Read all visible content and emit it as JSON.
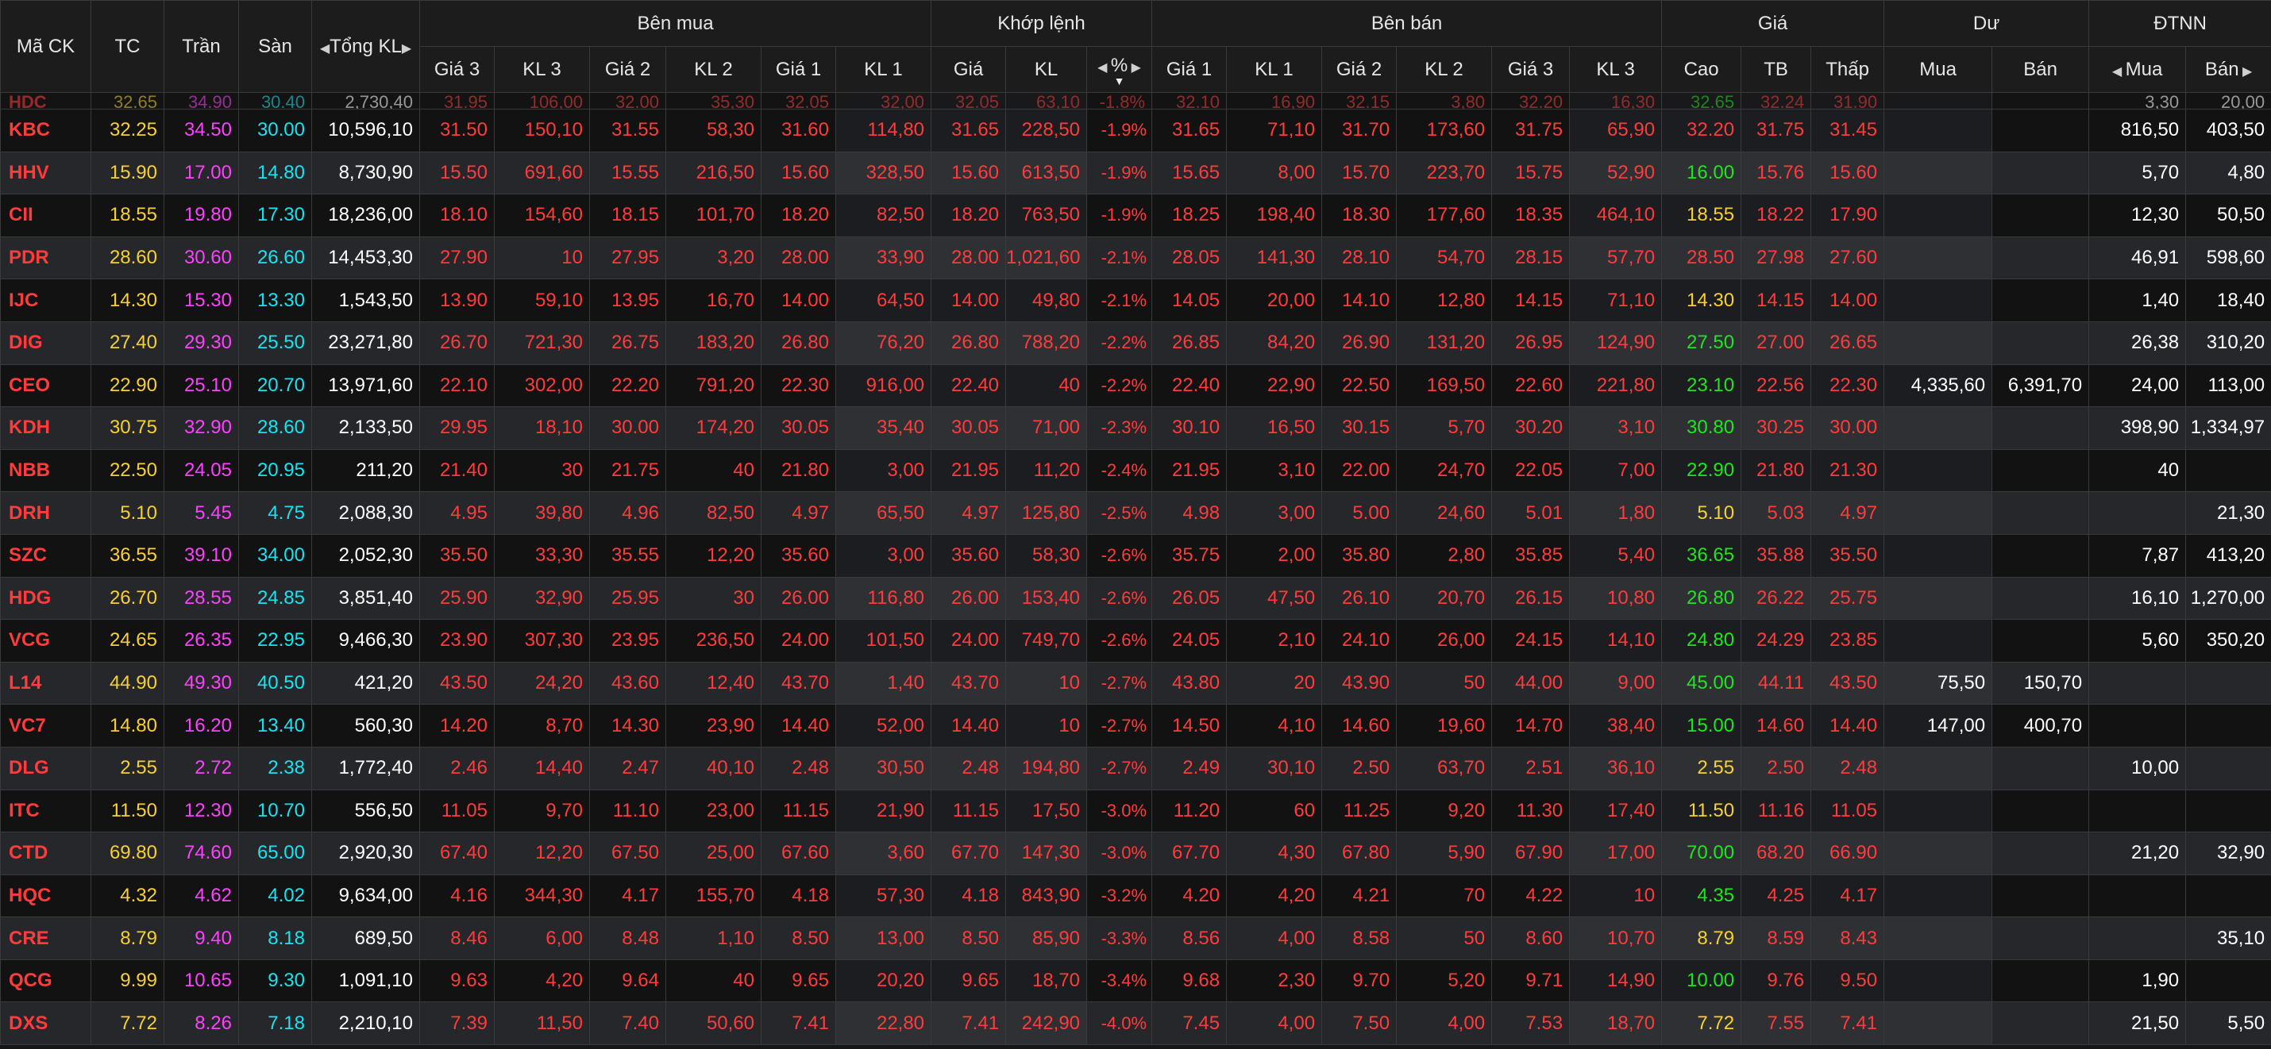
{
  "header": {
    "top": {
      "symbol": "Mã CK",
      "ref": "TC",
      "ceiling": "Trần",
      "floor": "Sàn",
      "total_volume": "Tổng KL",
      "buy": "Bên mua",
      "match": "Khớp lệnh",
      "sell": "Bên bán",
      "price": "Giá",
      "surplus": "Dư",
      "foreign": "ĐTNN"
    },
    "sub": {
      "buy": [
        "Giá 3",
        "KL 3",
        "Giá 2",
        "KL 2",
        "Giá 1",
        "KL 1"
      ],
      "match": [
        "Giá",
        "KL",
        "%"
      ],
      "sell": [
        "Giá 1",
        "KL 1",
        "Giá 2",
        "KL 2",
        "Giá 3",
        "KL 3"
      ],
      "price": [
        "Cao",
        "TB",
        "Thấp"
      ],
      "surplus": [
        "Mua",
        "Bán"
      ],
      "foreign": [
        "Mua",
        "Bán"
      ]
    }
  },
  "partial_row": [
    "HDC",
    "32.65",
    "34.90",
    "30.40",
    "2,730,40",
    "31.95",
    "106,00",
    "32.00",
    "35,30",
    "32.05",
    "32,00",
    "32.05",
    "63,10",
    "-1.8%",
    "32.10",
    "16,90",
    "32.15",
    "3,80",
    "32.20",
    "16,30",
    "32.65",
    "32.24",
    "31.90",
    "",
    "",
    "3,30",
    "20,00"
  ],
  "rows": [
    {
      "s": "KBC",
      "c": [
        "32.25",
        "34.50",
        "30.00",
        "10,596,10",
        "31.50",
        "150,10",
        "31.55",
        "58,30",
        "31.60",
        "114,80",
        "31.65",
        "228,50",
        "-1.9%",
        "31.65",
        "71,10",
        "31.70",
        "173,60",
        "31.75",
        "65,90",
        "32.20",
        "31.75",
        "31.45",
        "",
        "",
        "816,50",
        "403,50"
      ],
      "hi": "r"
    },
    {
      "s": "HHV",
      "c": [
        "15.90",
        "17.00",
        "14.80",
        "8,730,90",
        "15.50",
        "691,60",
        "15.55",
        "216,50",
        "15.60",
        "328,50",
        "15.60",
        "613,50",
        "-1.9%",
        "15.65",
        "8,00",
        "15.70",
        "223,70",
        "15.75",
        "52,90",
        "16.00",
        "15.76",
        "15.60",
        "",
        "",
        "5,70",
        "4,80"
      ],
      "hi": "g"
    },
    {
      "s": "CII",
      "c": [
        "18.55",
        "19.80",
        "17.30",
        "18,236,00",
        "18.10",
        "154,60",
        "18.15",
        "101,70",
        "18.20",
        "82,50",
        "18.20",
        "763,50",
        "-1.9%",
        "18.25",
        "198,40",
        "18.30",
        "177,60",
        "18.35",
        "464,10",
        "18.55",
        "18.22",
        "17.90",
        "",
        "",
        "12,30",
        "50,50"
      ],
      "hi": "y"
    },
    {
      "s": "PDR",
      "c": [
        "28.60",
        "30.60",
        "26.60",
        "14,453,30",
        "27.90",
        "10",
        "27.95",
        "3,20",
        "28.00",
        "33,90",
        "28.00",
        "1,021,60",
        "-2.1%",
        "28.05",
        "141,30",
        "28.10",
        "54,70",
        "28.15",
        "57,70",
        "28.50",
        "27.98",
        "27.60",
        "",
        "",
        "46,91",
        "598,60"
      ],
      "hi": "r"
    },
    {
      "s": "IJC",
      "c": [
        "14.30",
        "15.30",
        "13.30",
        "1,543,50",
        "13.90",
        "59,10",
        "13.95",
        "16,70",
        "14.00",
        "64,50",
        "14.00",
        "49,80",
        "-2.1%",
        "14.05",
        "20,00",
        "14.10",
        "12,80",
        "14.15",
        "71,10",
        "14.30",
        "14.15",
        "14.00",
        "",
        "",
        "1,40",
        "18,40"
      ],
      "hi": "y"
    },
    {
      "s": "DIG",
      "c": [
        "27.40",
        "29.30",
        "25.50",
        "23,271,80",
        "26.70",
        "721,30",
        "26.75",
        "183,20",
        "26.80",
        "76,20",
        "26.80",
        "788,20",
        "-2.2%",
        "26.85",
        "84,20",
        "26.90",
        "131,20",
        "26.95",
        "124,90",
        "27.50",
        "27.00",
        "26.65",
        "",
        "",
        "26,38",
        "310,20"
      ],
      "hi": "g"
    },
    {
      "s": "CEO",
      "c": [
        "22.90",
        "25.10",
        "20.70",
        "13,971,60",
        "22.10",
        "302,00",
        "22.20",
        "791,20",
        "22.30",
        "916,00",
        "22.40",
        "40",
        "-2.2%",
        "22.40",
        "22,90",
        "22.50",
        "169,50",
        "22.60",
        "221,80",
        "23.10",
        "22.56",
        "22.30",
        "4,335,60",
        "6,391,70",
        "24,00",
        "113,00"
      ],
      "hi": "g"
    },
    {
      "s": "KDH",
      "c": [
        "30.75",
        "32.90",
        "28.60",
        "2,133,50",
        "29.95",
        "18,10",
        "30.00",
        "174,20",
        "30.05",
        "35,40",
        "30.05",
        "71,00",
        "-2.3%",
        "30.10",
        "16,50",
        "30.15",
        "5,70",
        "30.20",
        "3,10",
        "30.80",
        "30.25",
        "30.00",
        "",
        "",
        "398,90",
        "1,334,97"
      ],
      "hi": "g"
    },
    {
      "s": "NBB",
      "c": [
        "22.50",
        "24.05",
        "20.95",
        "211,20",
        "21.40",
        "30",
        "21.75",
        "40",
        "21.80",
        "3,00",
        "21.95",
        "11,20",
        "-2.4%",
        "21.95",
        "3,10",
        "22.00",
        "24,70",
        "22.05",
        "7,00",
        "22.90",
        "21.80",
        "21.30",
        "",
        "",
        "40",
        ""
      ],
      "hi": "g"
    },
    {
      "s": "DRH",
      "c": [
        "5.10",
        "5.45",
        "4.75",
        "2,088,30",
        "4.95",
        "39,80",
        "4.96",
        "82,50",
        "4.97",
        "65,50",
        "4.97",
        "125,80",
        "-2.5%",
        "4.98",
        "3,00",
        "5.00",
        "24,60",
        "5.01",
        "1,80",
        "5.10",
        "5.03",
        "4.97",
        "",
        "",
        "",
        "21,30"
      ],
      "hi": "y"
    },
    {
      "s": "SZC",
      "c": [
        "36.55",
        "39.10",
        "34.00",
        "2,052,30",
        "35.50",
        "33,30",
        "35.55",
        "12,20",
        "35.60",
        "3,00",
        "35.60",
        "58,30",
        "-2.6%",
        "35.75",
        "2,00",
        "35.80",
        "2,80",
        "35.85",
        "5,40",
        "36.65",
        "35.88",
        "35.50",
        "",
        "",
        "7,87",
        "413,20"
      ],
      "hi": "g"
    },
    {
      "s": "HDG",
      "c": [
        "26.70",
        "28.55",
        "24.85",
        "3,851,40",
        "25.90",
        "32,90",
        "25.95",
        "30",
        "26.00",
        "116,80",
        "26.00",
        "153,40",
        "-2.6%",
        "26.05",
        "47,50",
        "26.10",
        "20,70",
        "26.15",
        "10,80",
        "26.80",
        "26.22",
        "25.75",
        "",
        "",
        "16,10",
        "1,270,00"
      ],
      "hi": "g"
    },
    {
      "s": "VCG",
      "c": [
        "24.65",
        "26.35",
        "22.95",
        "9,466,30",
        "23.90",
        "307,30",
        "23.95",
        "236,50",
        "24.00",
        "101,50",
        "24.00",
        "749,70",
        "-2.6%",
        "24.05",
        "2,10",
        "24.10",
        "26,00",
        "24.15",
        "14,10",
        "24.80",
        "24.29",
        "23.85",
        "",
        "",
        "5,60",
        "350,20"
      ],
      "hi": "g"
    },
    {
      "s": "L14",
      "c": [
        "44.90",
        "49.30",
        "40.50",
        "421,20",
        "43.50",
        "24,20",
        "43.60",
        "12,40",
        "43.70",
        "1,40",
        "43.70",
        "10",
        "-2.7%",
        "43.80",
        "20",
        "43.90",
        "50",
        "44.00",
        "9,00",
        "45.00",
        "44.11",
        "43.50",
        "75,50",
        "150,70",
        "",
        ""
      ],
      "hi": "g"
    },
    {
      "s": "VC7",
      "c": [
        "14.80",
        "16.20",
        "13.40",
        "560,30",
        "14.20",
        "8,70",
        "14.30",
        "23,90",
        "14.40",
        "52,00",
        "14.40",
        "10",
        "-2.7%",
        "14.50",
        "4,10",
        "14.60",
        "19,60",
        "14.70",
        "38,40",
        "15.00",
        "14.60",
        "14.40",
        "147,00",
        "400,70",
        "",
        ""
      ],
      "hi": "g"
    },
    {
      "s": "DLG",
      "c": [
        "2.55",
        "2.72",
        "2.38",
        "1,772,40",
        "2.46",
        "14,40",
        "2.47",
        "40,10",
        "2.48",
        "30,50",
        "2.48",
        "194,80",
        "-2.7%",
        "2.49",
        "30,10",
        "2.50",
        "63,70",
        "2.51",
        "36,10",
        "2.55",
        "2.50",
        "2.48",
        "",
        "",
        "10,00",
        ""
      ],
      "hi": "y"
    },
    {
      "s": "ITC",
      "c": [
        "11.50",
        "12.30",
        "10.70",
        "556,50",
        "11.05",
        "9,70",
        "11.10",
        "23,00",
        "11.15",
        "21,90",
        "11.15",
        "17,50",
        "-3.0%",
        "11.20",
        "60",
        "11.25",
        "9,20",
        "11.30",
        "17,40",
        "11.50",
        "11.16",
        "11.05",
        "",
        "",
        "",
        ""
      ],
      "hi": "y"
    },
    {
      "s": "CTD",
      "c": [
        "69.80",
        "74.60",
        "65.00",
        "2,920,30",
        "67.40",
        "12,20",
        "67.50",
        "25,00",
        "67.60",
        "3,60",
        "67.70",
        "147,30",
        "-3.0%",
        "67.70",
        "4,30",
        "67.80",
        "5,90",
        "67.90",
        "17,00",
        "70.00",
        "68.20",
        "66.90",
        "",
        "",
        "21,20",
        "32,90"
      ],
      "hi": "g"
    },
    {
      "s": "HQC",
      "c": [
        "4.32",
        "4.62",
        "4.02",
        "9,634,00",
        "4.16",
        "344,30",
        "4.17",
        "155,70",
        "4.18",
        "57,30",
        "4.18",
        "843,90",
        "-3.2%",
        "4.20",
        "4,20",
        "4.21",
        "70",
        "4.22",
        "10",
        "4.35",
        "4.25",
        "4.17",
        "",
        "",
        "",
        ""
      ],
      "hi": "g"
    },
    {
      "s": "CRE",
      "c": [
        "8.79",
        "9.40",
        "8.18",
        "689,50",
        "8.46",
        "6,00",
        "8.48",
        "1,10",
        "8.50",
        "13,00",
        "8.50",
        "85,90",
        "-3.3%",
        "8.56",
        "4,00",
        "8.58",
        "50",
        "8.60",
        "10,70",
        "8.79",
        "8.59",
        "8.43",
        "",
        "",
        "",
        "35,10"
      ],
      "hi": "y"
    },
    {
      "s": "QCG",
      "c": [
        "9.99",
        "10.65",
        "9.30",
        "1,091,10",
        "9.63",
        "4,20",
        "9.64",
        "40",
        "9.65",
        "20,20",
        "9.65",
        "18,70",
        "-3.4%",
        "9.68",
        "2,30",
        "9.70",
        "5,20",
        "9.71",
        "14,90",
        "10.00",
        "9.76",
        "9.50",
        "",
        "",
        "1,90",
        ""
      ],
      "hi": "g"
    },
    {
      "s": "DXS",
      "c": [
        "7.72",
        "8.26",
        "7.18",
        "2,210,10",
        "7.39",
        "11,50",
        "7.40",
        "50,60",
        "7.41",
        "22,80",
        "7.41",
        "242,90",
        "-4.0%",
        "7.45",
        "4,00",
        "7.50",
        "4,00",
        "7.53",
        "18,70",
        "7.72",
        "7.55",
        "7.41",
        "",
        "",
        "21,50",
        "5,50"
      ],
      "hi": "y"
    }
  ],
  "colors": {
    "red": "#ff3b3b",
    "ref": "#f8d030",
    "ceiling": "#ff40ff",
    "floor": "#18e3f0",
    "up": "#1ee61e",
    "neutral": "#ffffff"
  }
}
